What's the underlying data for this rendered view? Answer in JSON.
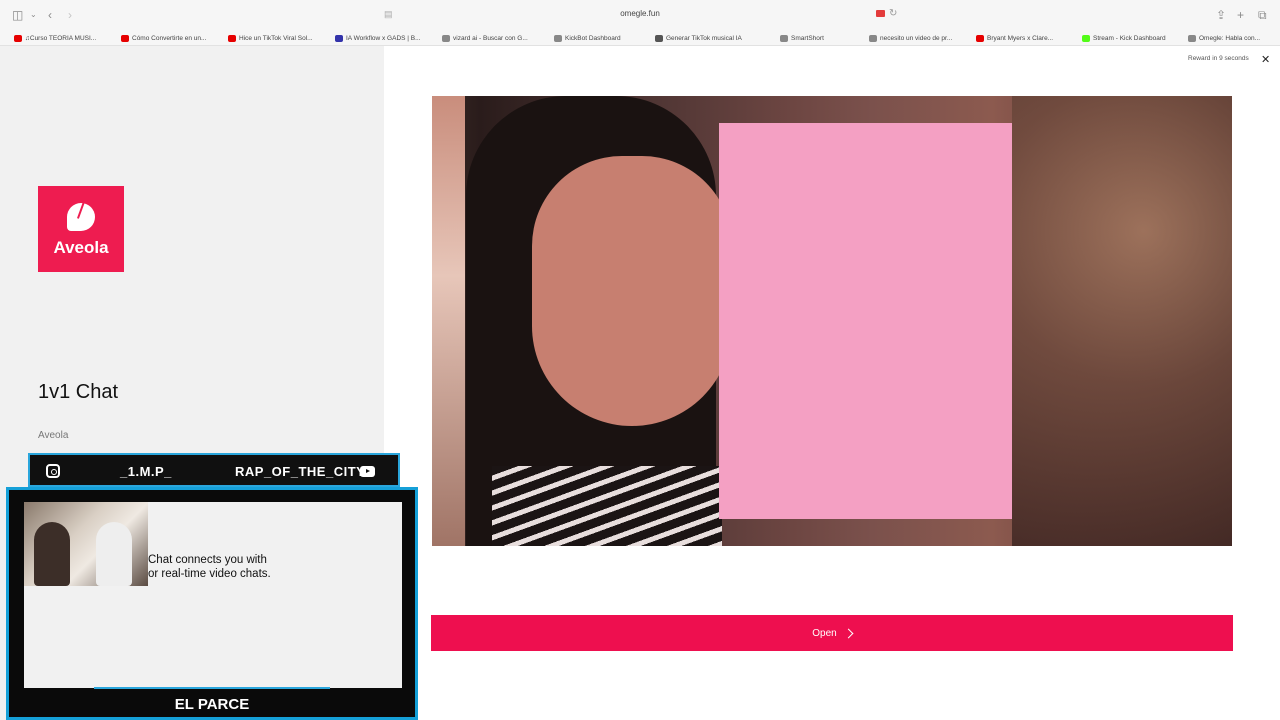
{
  "browser": {
    "url": "omegle.fun",
    "bookmarks": [
      {
        "label": "♫Curso TEORIA MUSI...",
        "color": "#e60000"
      },
      {
        "label": "Cómo Convertirte en un...",
        "color": "#e60000"
      },
      {
        "label": "Hice un TikTok Viral Sol...",
        "color": "#e60000"
      },
      {
        "label": "IA Workflow x GADS | B...",
        "color": "#3333aa"
      },
      {
        "label": "vizard ai - Buscar con G...",
        "color": "#888888"
      },
      {
        "label": "KickBot Dashboard",
        "color": "#888888"
      },
      {
        "label": "Generar TikTok musical IA",
        "color": "#555555"
      },
      {
        "label": "SmartShort",
        "color": "#888888"
      },
      {
        "label": "necesito un video de pr...",
        "color": "#888888"
      },
      {
        "label": "Bryant Myers x Clare...",
        "color": "#e60000"
      },
      {
        "label": "Stream - Kick Dashboard",
        "color": "#53fc18"
      },
      {
        "label": "Omegle: Habla con...",
        "color": "#888888"
      }
    ]
  },
  "ad": {
    "logo_text": "Aveola",
    "title": "1v1 Chat",
    "brand": "Aveola",
    "description_line1": "Chat connects you with",
    "description_line2": "or real-time video chats."
  },
  "overlay": {
    "left_handle": "_1.M.P_",
    "right_handle": "RAP_OF_THE_CITY",
    "name": "EL PARCE"
  },
  "main": {
    "reward_text": "Reward in 9 seconds",
    "close_label": "✕",
    "open_label": "Open"
  },
  "colors": {
    "accent": "#ee0f4f",
    "overlay_border": "#15a0d8"
  }
}
